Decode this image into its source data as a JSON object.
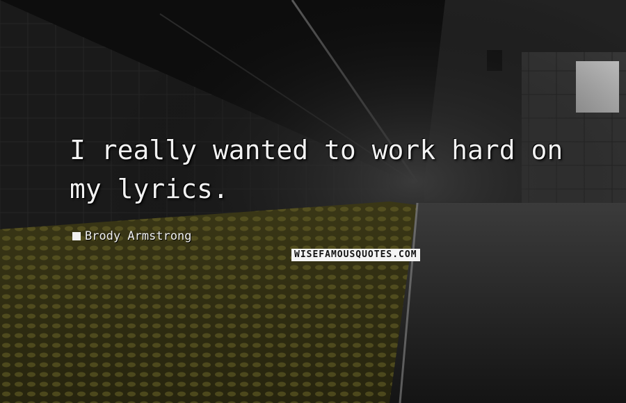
{
  "quote": {
    "text": "I really wanted to work hard on my lyrics.",
    "author": "Brody Armstrong"
  },
  "watermark": {
    "text": "WISEFAMOUSQUOTES.COM"
  },
  "colors": {
    "text": "#f2f2f2",
    "background": "#0b0b0b",
    "tactile_strip": "#5a5420"
  }
}
